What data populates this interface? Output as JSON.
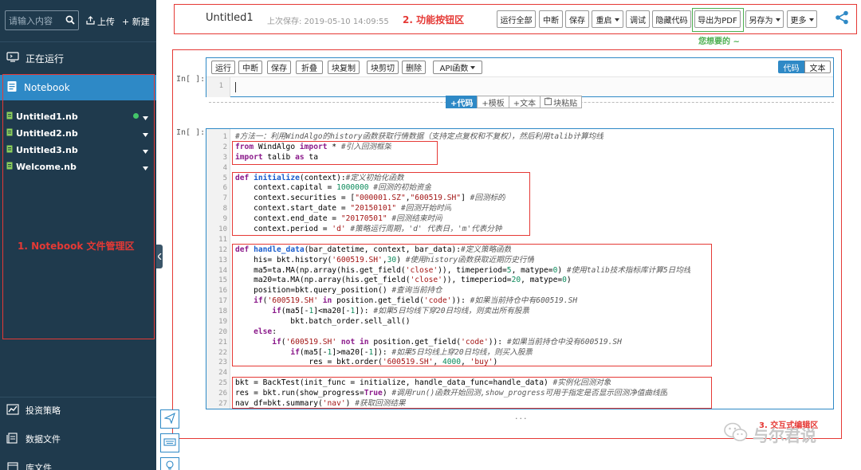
{
  "sidebar": {
    "search_placeholder": "请输入内容",
    "upload_label": "上传",
    "new_label": "+ 新建",
    "running_label": "正在运行",
    "notebook_label": "Notebook",
    "files": [
      {
        "name": "Untitled1.nb",
        "running": true
      },
      {
        "name": "Untitled2.nb",
        "running": false
      },
      {
        "name": "Untitled3.nb",
        "running": false
      },
      {
        "name": "Welcome.nb",
        "running": false
      }
    ],
    "panel_annotation": "1. Notebook 文件管理区",
    "bottom_items": [
      {
        "label": "投资策略",
        "icon": "trend-chart-icon"
      },
      {
        "label": "数据文件",
        "icon": "data-file-icon"
      },
      {
        "label": "库文件",
        "icon": "library-icon"
      }
    ]
  },
  "header": {
    "title": "Untitled1",
    "last_save": "上次保存: 2019-05-10 14:09:55",
    "annotation": "2. 功能按钮区",
    "buttons": [
      {
        "label": "运行全部",
        "dropdown": false
      },
      {
        "label": "中断",
        "dropdown": false
      },
      {
        "label": "保存",
        "dropdown": false
      },
      {
        "label": "重启",
        "dropdown": true
      },
      {
        "label": "调试",
        "dropdown": false
      },
      {
        "label": "隐藏代码",
        "dropdown": false
      },
      {
        "label": "导出为PDF",
        "dropdown": false
      },
      {
        "label": "另存为",
        "dropdown": true
      },
      {
        "label": "更多",
        "dropdown": true
      }
    ],
    "pdf_annotation": "您想要的 ~"
  },
  "cell1": {
    "prompt": "In[ ]:",
    "buttons": [
      {
        "label": "运行",
        "dropdown": false
      },
      {
        "label": "中断",
        "dropdown": false
      },
      {
        "label": "保存",
        "dropdown": false
      },
      {
        "label": "折叠",
        "dropdown": false
      },
      {
        "label": "块复制",
        "dropdown": false
      },
      {
        "label": "块剪切",
        "dropdown": false
      },
      {
        "label": "删除",
        "dropdown": false
      },
      {
        "label": "API函数",
        "dropdown": true
      }
    ],
    "mode_code": "代码",
    "mode_text": "文本",
    "line_number": "1"
  },
  "insert_bar": {
    "code": "+代码",
    "template": "+模板",
    "text": "+文本",
    "paste": "块粘贴"
  },
  "cell2": {
    "prompt": "In[ ]:",
    "more": "...",
    "annotation": "3. 交互式编辑区"
  },
  "watermark": "与尔君说",
  "colors": {
    "sidebar_bg": "#1f3a4d",
    "accent": "#2e89c6",
    "annotation_red": "#e53935",
    "annotation_green": "#4caf50"
  }
}
